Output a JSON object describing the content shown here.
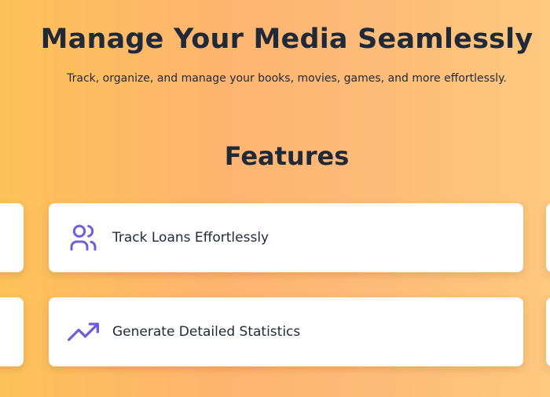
{
  "hero": {
    "title": "Manage Your Media Seamlessly",
    "subtitle": "Track, organize, and manage your books, movies, games, and more effortlessly."
  },
  "features": {
    "heading": "Features",
    "items": [
      {
        "label": "Track Loans Effortlessly",
        "icon": "users-icon"
      },
      {
        "label": "Generate Detailed Statistics",
        "icon": "trending-up-icon"
      }
    ]
  },
  "colors": {
    "icon_accent": "#6e5fd8",
    "text_primary": "#1f2937",
    "card_background": "#ffffff",
    "background_gradient": [
      "#fdc25a",
      "#fdb46f",
      "#fdc880"
    ]
  }
}
